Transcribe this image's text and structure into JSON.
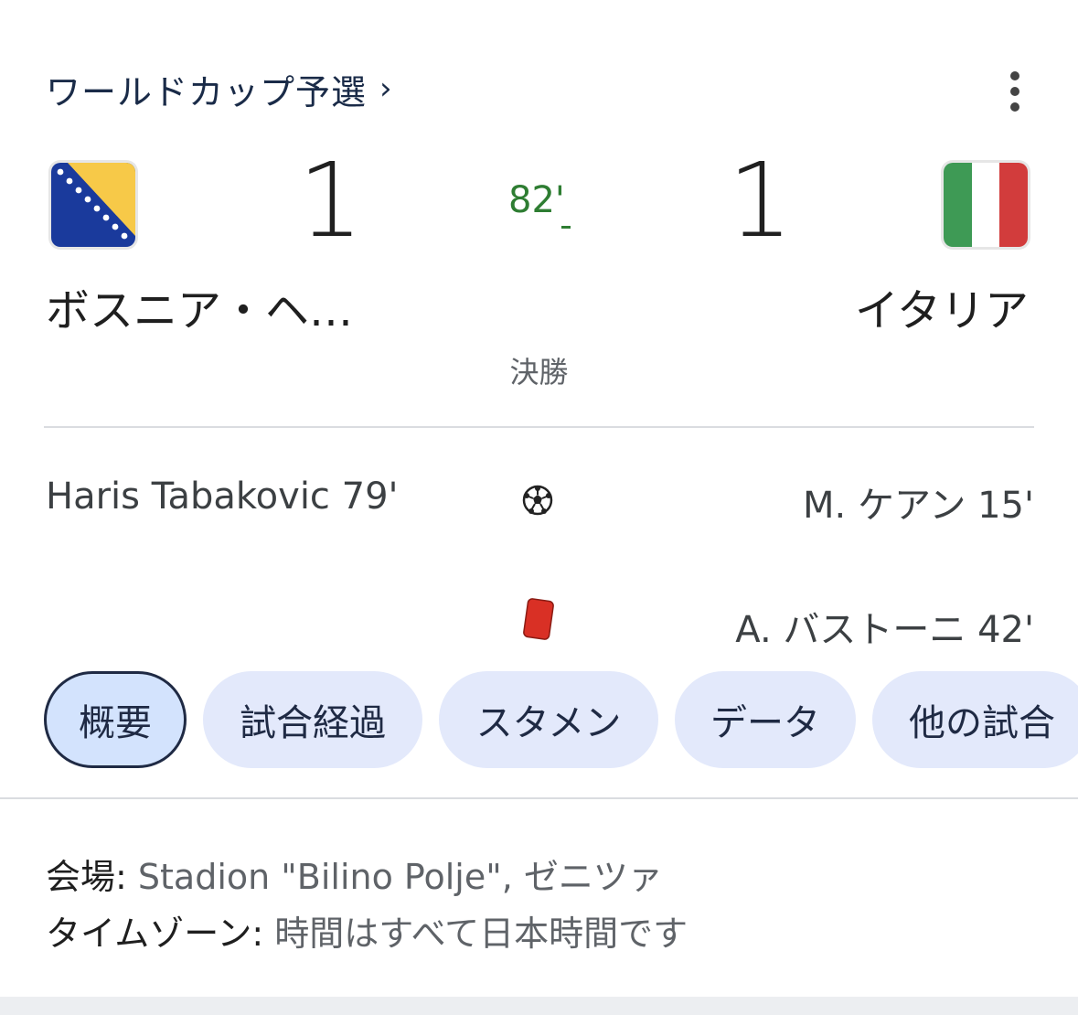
{
  "header": {
    "competition": "ワールドカップ予選",
    "chevron": "›",
    "menu_icon": "more-vert-icon"
  },
  "match": {
    "home": {
      "name": "ボスニア・ヘ…",
      "score": "1",
      "flag": "bosnia-flag"
    },
    "away": {
      "name": "イタリア",
      "score": "1",
      "flag": "italy-flag"
    },
    "minute": "82'",
    "stage": "決勝"
  },
  "events": {
    "home_goal": "Haris Tabakovic 79'",
    "away_goal": "M. ケアン 15'",
    "away_red_card": "A. バストーニ 42'"
  },
  "tabs": [
    {
      "label": "概要",
      "active": true
    },
    {
      "label": "試合経過",
      "active": false
    },
    {
      "label": "スタメン",
      "active": false
    },
    {
      "label": "データ",
      "active": false
    },
    {
      "label": "他の試合",
      "active": false
    }
  ],
  "info": {
    "venue_label": "会場:",
    "venue_value": "Stadion \"Bilino Polje\", ゼニツァ",
    "timezone_label": "タイムゾーン:",
    "timezone_value": "時間はすべて日本時間です"
  },
  "colors": {
    "live_minute": "#2e7d32",
    "chip_bg": "#e3e9fb",
    "chip_active_bg": "#d3e3fd",
    "red_card": "#d93025"
  }
}
